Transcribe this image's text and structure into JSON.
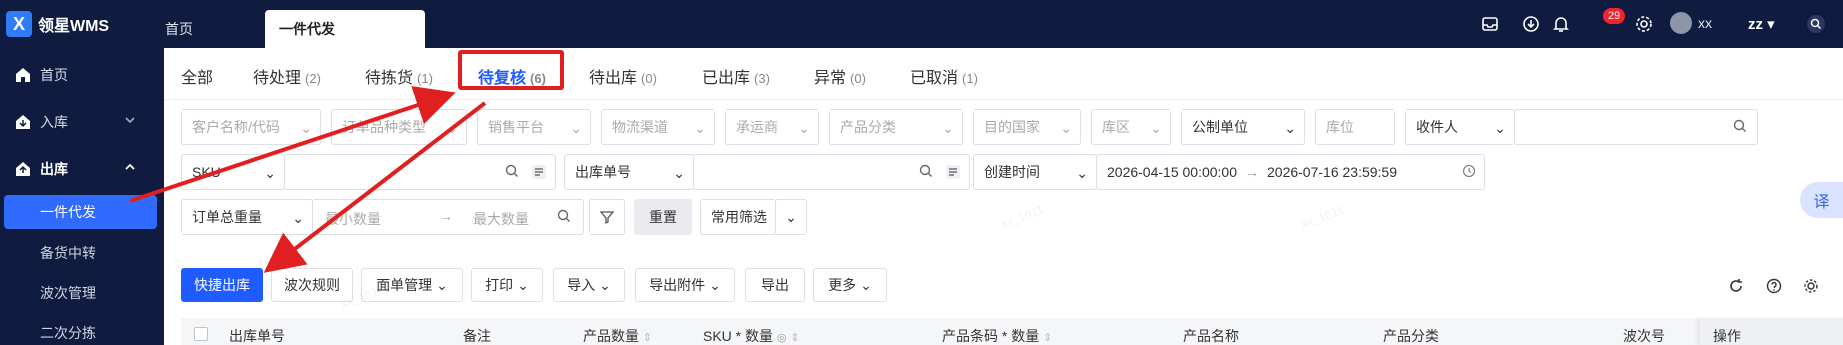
{
  "app": {
    "name": "领星WMS",
    "logo_letter": "X"
  },
  "top_tabs": [
    {
      "label": "首页"
    },
    {
      "label": "一件代发"
    }
  ],
  "header": {
    "notification_count": "29",
    "user_name": "xx",
    "org": "zz"
  },
  "sidebar": {
    "items": [
      {
        "label": "首页",
        "icon": "home-icon"
      },
      {
        "label": "入库",
        "icon": "inbound-icon"
      },
      {
        "label": "出库",
        "icon": "outbound-icon"
      }
    ],
    "sub_items": [
      "一件代发",
      "备货中转",
      "波次管理",
      "二次分拣"
    ]
  },
  "status_tabs": [
    {
      "label": "全部",
      "count": ""
    },
    {
      "label": "待处理",
      "count": "(2)"
    },
    {
      "label": "待拣货",
      "count": "(1)"
    },
    {
      "label": "待复核",
      "count": "(6)"
    },
    {
      "label": "待出库",
      "count": "(0)"
    },
    {
      "label": "已出库",
      "count": "(3)"
    },
    {
      "label": "异常",
      "count": "(0)"
    },
    {
      "label": "已取消",
      "count": "(1)"
    }
  ],
  "filters": {
    "row1": [
      "客户名称/代码",
      "订单品种类型",
      "销售平台",
      "物流渠道",
      "承运商",
      "产品分类",
      "目的国家",
      "库区",
      "公制单位",
      "库位",
      "收件人"
    ],
    "sku_select": "SKU",
    "order_no_select": "出库单号",
    "time_select": "创建时间",
    "date_start": "2026-04-15 00:00:00",
    "date_end": "2026-07-16 23:59:59",
    "weight_select": "订单总重量",
    "min_placeholder": "最小数量",
    "max_placeholder": "最大数量",
    "reset": "重置",
    "common_filter": "常用筛选"
  },
  "toolbar": {
    "buttons": [
      "快捷出库",
      "波次规则",
      "面单管理",
      "打印",
      "导入",
      "导出附件",
      "导出",
      "更多"
    ]
  },
  "table": {
    "columns": [
      "出库单号",
      "备注",
      "产品数量",
      "SKU * 数量",
      "产品条码 * 数量",
      "产品名称",
      "产品分类",
      "波次号",
      "操作"
    ]
  },
  "translate_label": "译",
  "watermark": "xx_1011",
  "colors": {
    "primary": "#1f5cff",
    "topbar": "#0f1c3f",
    "highlight": "#e02020"
  }
}
